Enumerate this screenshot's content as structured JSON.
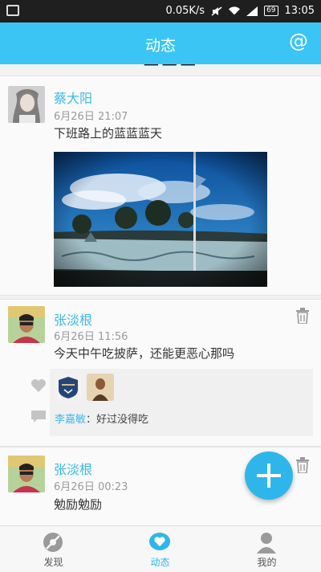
{
  "status_bar": {
    "speed": "0.05K/s",
    "battery": "69",
    "time": "13:05"
  },
  "nav": {
    "title": "动态",
    "at_symbol": "@"
  },
  "posts": [
    {
      "name": "蔡大阳",
      "time": "6月26日 21:07",
      "content": "下班路上的蓝蓝蓝天"
    },
    {
      "name": "张淡根",
      "time": "6月26日 11:56",
      "content": "今天中午吃披萨，还能更恶心那吗",
      "comment": {
        "author": "李嘉敏",
        "separator": "：",
        "text": "好过没得吃"
      }
    },
    {
      "name": "张淡根",
      "time": "6月26日 00:23",
      "content": "勉励勉励"
    }
  ],
  "tabs": [
    {
      "label": "发现"
    },
    {
      "label": "动态"
    },
    {
      "label": "我的"
    }
  ],
  "colors": {
    "accent": "#3bc5f4",
    "link": "#3bb9ea",
    "fab": "#2eb6ea"
  },
  "icons": [
    "image-icon",
    "wifi-icon",
    "signal-icon",
    "at-icon",
    "trash-icon",
    "heart-icon",
    "comment-icon",
    "plus-icon",
    "discover-icon",
    "feed-icon",
    "profile-icon"
  ]
}
